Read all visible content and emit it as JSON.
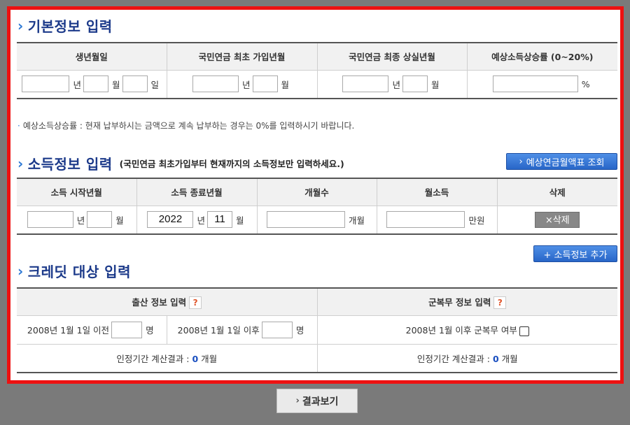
{
  "basic": {
    "title": "기본정보 입력",
    "headers": [
      "생년월일",
      "국민연금 최초 가입년월",
      "국민연금 최종 상실년월",
      "예상소득상승률 (0~20%)"
    ],
    "year_unit": "년",
    "month_unit": "월",
    "day_unit": "일",
    "percent_unit": "%",
    "note": "예상소득상승률 : 현재 납부하시는 금액으로 계속 납부하는 경우는 0%를 입력하시기 바랍니다."
  },
  "income": {
    "title": "소득정보 입력",
    "subtitle": "(국민연금 최초가입부터 현재까지의 소득정보만 입력하세요.)",
    "lookup_button": "예상연금월액표 조회",
    "headers": [
      "소득 시작년월",
      "소득 종료년월",
      "개월수",
      "월소득",
      "삭제"
    ],
    "end_year": "2022",
    "end_month": "11",
    "months_unit": "개월",
    "won_unit": "만원",
    "delete_button": "×삭제",
    "add_button": "+ 소득정보 추가"
  },
  "credit": {
    "title": "크레딧 대상 입력",
    "birth_header": "출산 정보 입력",
    "military_header": "군복무 정보 입력",
    "help_mark": "?",
    "before_label": "2008년 1월 1일 이전",
    "after_label": "2008년 1월 1일 이후",
    "person_unit": "명",
    "military_label": "2008년 1월 이후 군복무 여부",
    "result_label": "인정기간 계산결과 :",
    "birth_result": "0",
    "military_result": "0",
    "result_unit": "개월"
  },
  "result_button": "결과보기",
  "colors": {
    "frame": "#ee1111",
    "title": "#1c3a8a",
    "button": "#2866c8"
  }
}
